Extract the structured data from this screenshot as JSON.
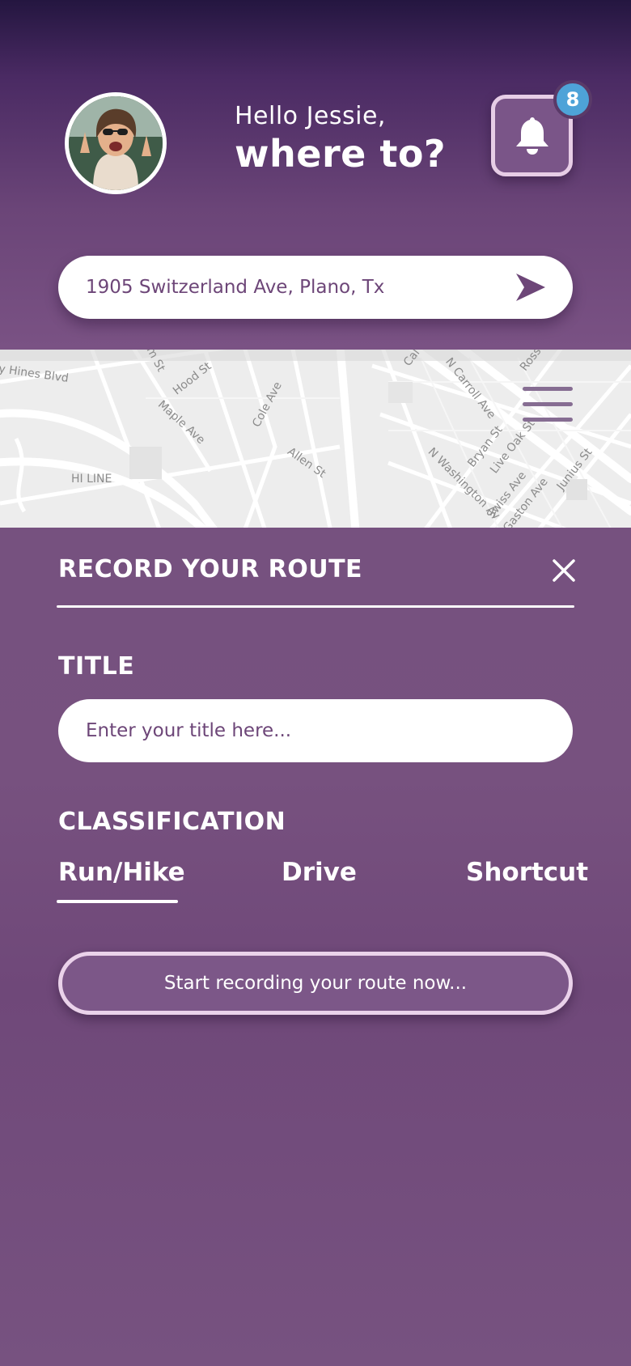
{
  "header": {
    "hello": "Hello Jessie,",
    "where": "where to?",
    "notifications_count": "8",
    "avatar_icon": "user-avatar-photo",
    "bell_icon": "bell-icon"
  },
  "search": {
    "address": "1905 Switzerland Ave, Plano, Tx",
    "send_icon": "send-arrow-icon"
  },
  "map": {
    "street_labels": [
      "y Hines Blvd",
      "Hood St",
      "Maple Ave",
      "Cole Ave",
      "Allen St",
      "HI LINE",
      "N Carroll Ave",
      "Bryan St",
      "Live Oak St",
      "N Washington Av",
      "Swiss Ave",
      "Gaston Ave",
      "Junius St",
      "Ross",
      "Cal",
      "m St"
    ],
    "menu_icon": "hamburger-menu-icon"
  },
  "panel": {
    "heading": "RECORD YOUR ROUTE",
    "close_icon": "close-icon",
    "title_label": "TITLE",
    "title_placeholder": "Enter your title here...",
    "classification_label": "CLASSIFICATION",
    "tabs": [
      {
        "label": "Run/Hike",
        "selected": true
      },
      {
        "label": "Drive",
        "selected": false
      },
      {
        "label": "Shortcut",
        "selected": false
      }
    ],
    "record_button": "Start recording your route now..."
  },
  "colors": {
    "accent_purple": "#76507f",
    "header_dark": "#241640",
    "badge_blue": "#4ea3d8",
    "text_purple": "#6d4678"
  }
}
